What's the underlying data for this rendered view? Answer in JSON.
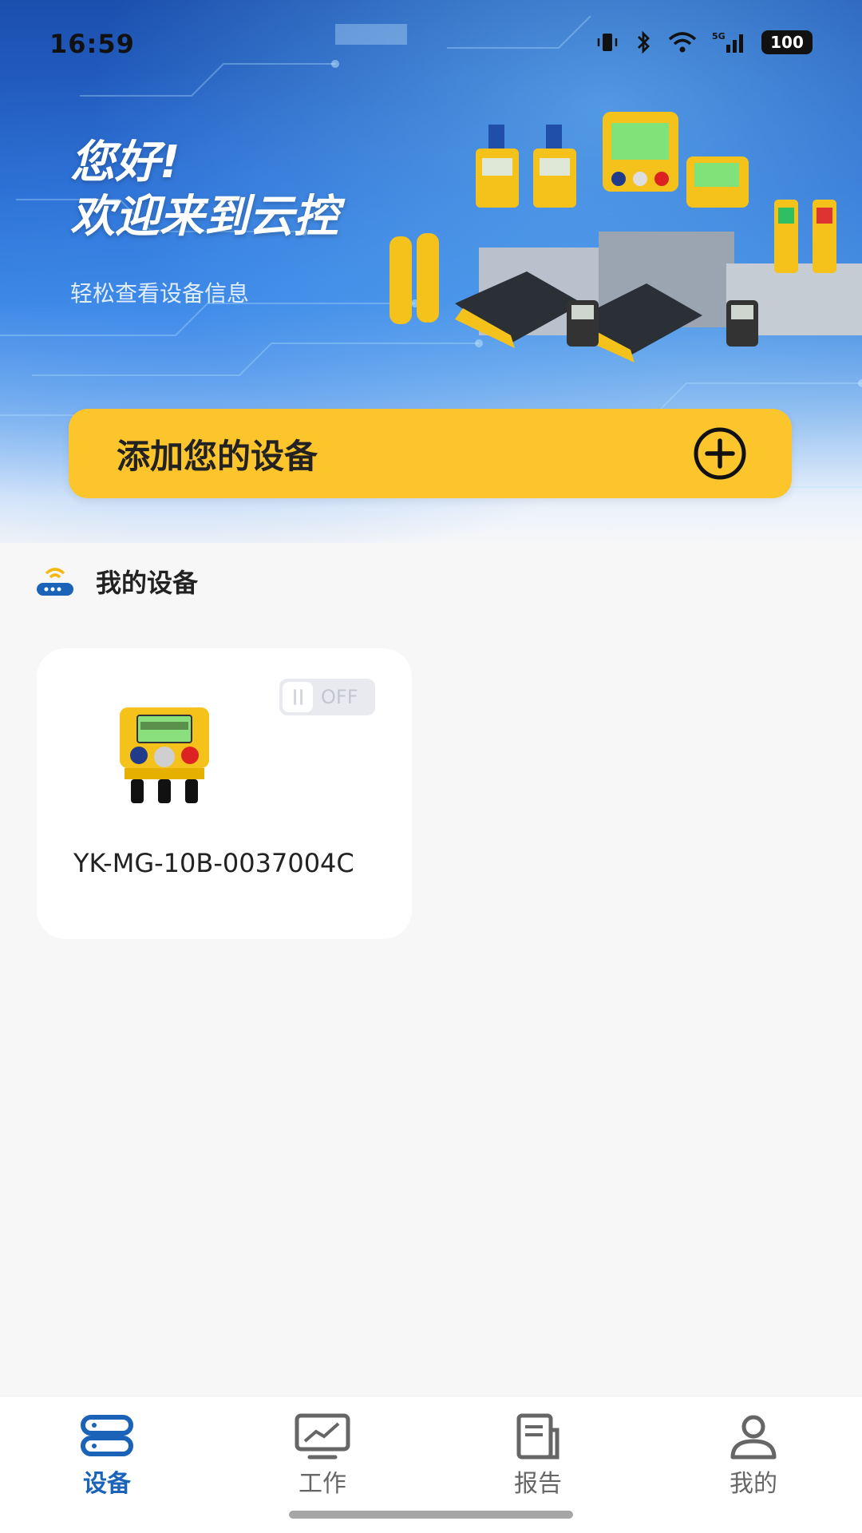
{
  "status_bar": {
    "time": "16:59",
    "battery": "100",
    "network": "5G"
  },
  "hero": {
    "greeting_line1": "您好!",
    "greeting_line2": "欢迎来到云控",
    "subtitle": "轻松查看设备信息"
  },
  "add_device": {
    "label": "添加您的设备",
    "icon": "plus-circle-icon"
  },
  "my_devices": {
    "title": "我的设备",
    "icon": "router-wifi-icon",
    "items": [
      {
        "name": "YK-MG-10B-0037004C",
        "toggle_label": "OFF",
        "status": "off"
      }
    ]
  },
  "bottom_nav": {
    "items": [
      {
        "label": "设备",
        "icon": "device-icon",
        "active": true
      },
      {
        "label": "工作",
        "icon": "monitor-chart-icon",
        "active": false
      },
      {
        "label": "报告",
        "icon": "report-icon",
        "active": false
      },
      {
        "label": "我的",
        "icon": "user-icon",
        "active": false
      }
    ]
  },
  "colors": {
    "accent": "#fcc52c",
    "primary": "#1a63b8",
    "hero_blue": "#2a6bd0"
  }
}
